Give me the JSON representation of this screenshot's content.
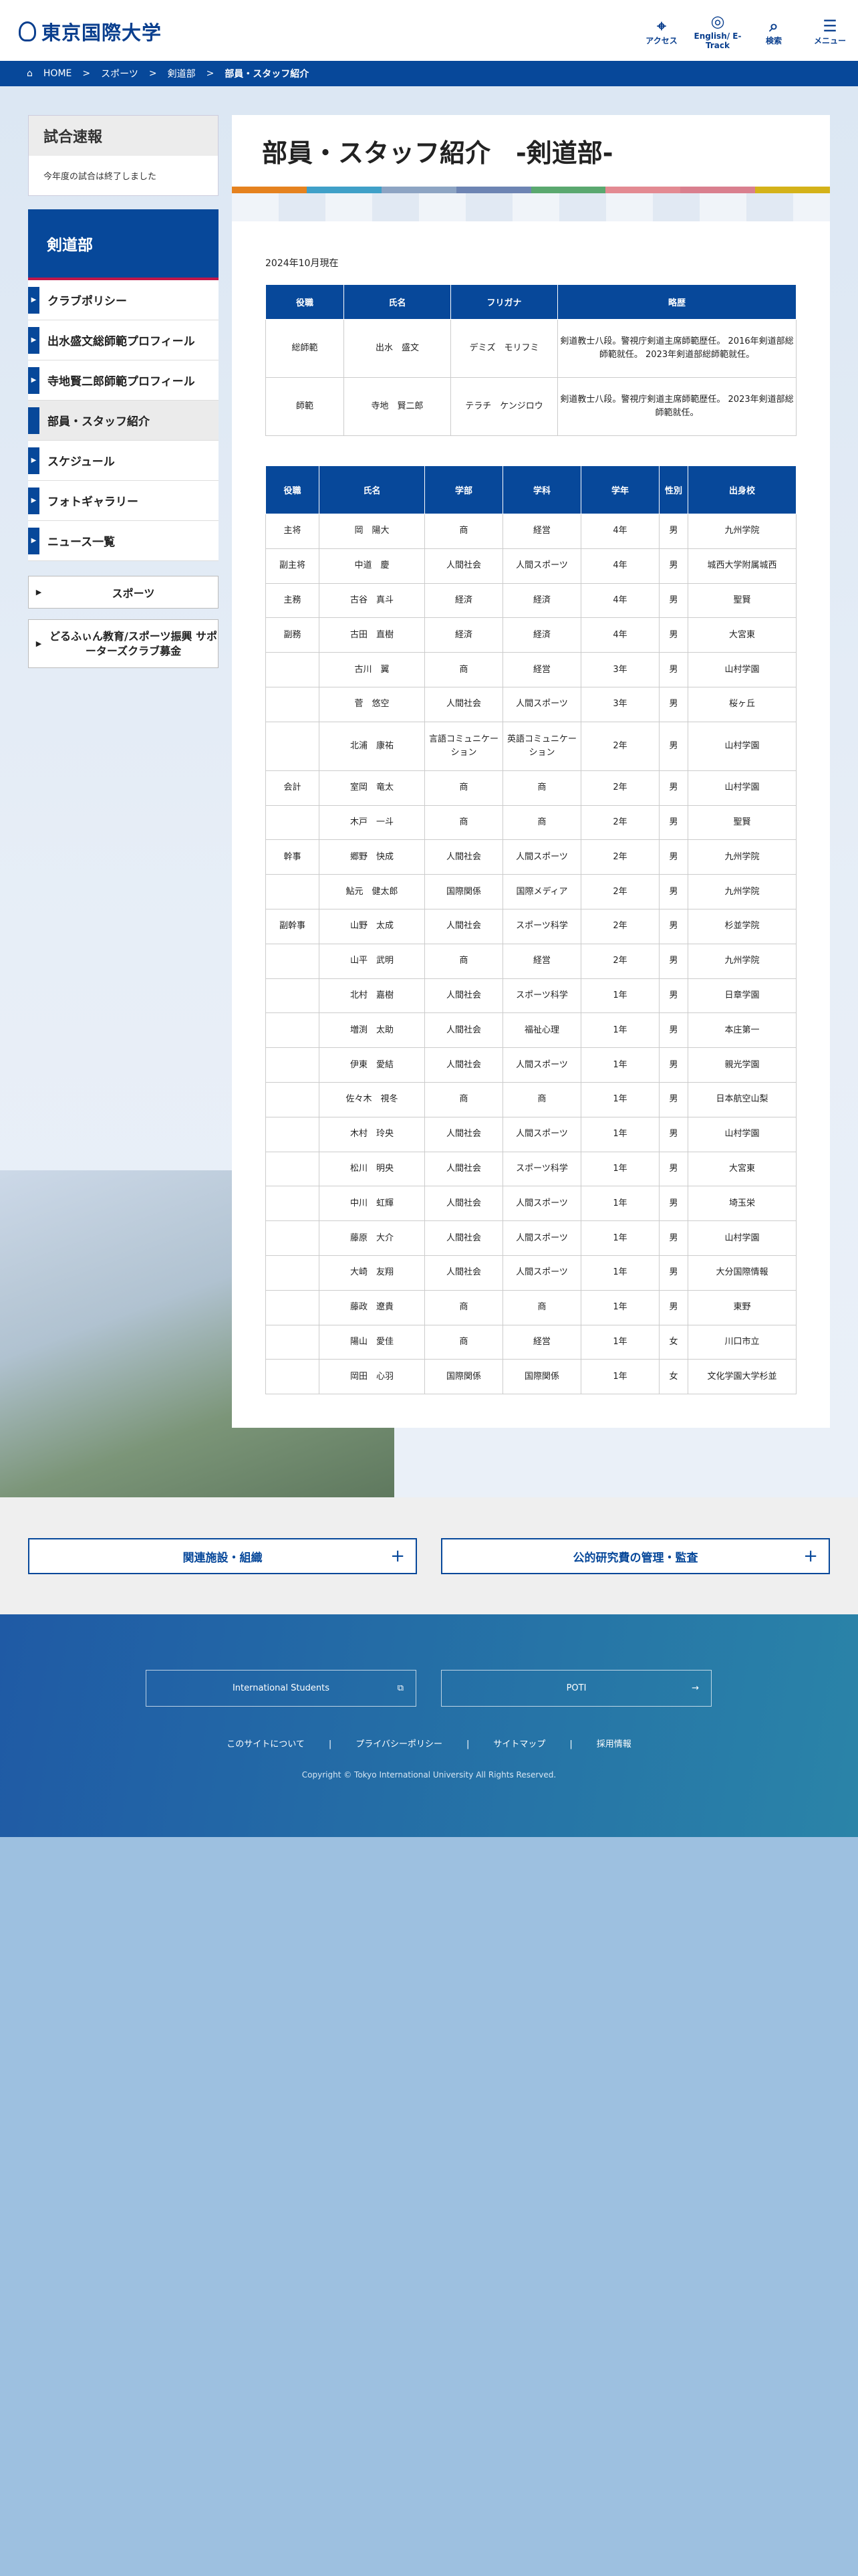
{
  "header": {
    "logo": "東京国際大学",
    "icons": [
      {
        "name": "map-pin-icon",
        "glyph": "⌖",
        "label": "アクセス"
      },
      {
        "name": "globe-icon",
        "glyph": "◎",
        "label": "English/ E-Track"
      },
      {
        "name": "search-icon",
        "glyph": "⌕",
        "label": "検索"
      },
      {
        "name": "menu-icon",
        "glyph": "☰",
        "label": "メニュー"
      }
    ]
  },
  "breadcrumb": [
    "HOME",
    "スポーツ",
    "剣道部",
    "部員・スタッフ紹介"
  ],
  "sidebar": {
    "score_title": "試合速報",
    "score_text": "今年度の試合は終了しました",
    "club_title": "剣道部",
    "menu": [
      "クラブポリシー",
      "出水盛文総師範プロフィール",
      "寺地賢二郎師範プロフィール",
      "部員・スタッフ紹介",
      "スケジュール",
      "フォトギャラリー",
      "ニュース一覧"
    ],
    "active_index": 3,
    "btn_sports": "スポーツ",
    "btn_support": "どるふぃん教育/スポーツ振興 サポーターズクラブ募金"
  },
  "main": {
    "title": "部員・スタッフ紹介　-剣道部-",
    "date": "2024年10月現在",
    "bar_colors": [
      "#e5821f",
      "#3fa0c8",
      "#8da4c3",
      "#6d84b3",
      "#5aa86f",
      "#e38a92",
      "#d97f8e",
      "#d4b219"
    ],
    "staff_headers": [
      "役職",
      "氏名",
      "フリガナ",
      "略歴"
    ],
    "staff": [
      [
        "総師範",
        "出水　盛文",
        "デミズ　モリフミ",
        "剣道教士八段。警視庁剣道主席師範歴任。 2016年剣道部総師範就任。 2023年剣道部総師範就任。"
      ],
      [
        "師範",
        "寺地　賢二郎",
        "テラチ　ケンジロウ",
        "剣道教士八段。警視庁剣道主席師範歴任。 2023年剣道部総師範就任。"
      ]
    ],
    "member_headers": [
      "役職",
      "氏名",
      "学部",
      "学科",
      "学年",
      "性別",
      "出身校"
    ],
    "members": [
      [
        "主将",
        "岡　陽大",
        "商",
        "経営",
        "4年",
        "男",
        "九州学院"
      ],
      [
        "副主将",
        "中道　慶",
        "人間社会",
        "人間スポーツ",
        "4年",
        "男",
        "城西大学附属城西"
      ],
      [
        "主務",
        "古谷　真斗",
        "経済",
        "経済",
        "4年",
        "男",
        "聖賢"
      ],
      [
        "副務",
        "古田　直樹",
        "経済",
        "経済",
        "4年",
        "男",
        "大宮東"
      ],
      [
        "",
        "古川　翼",
        "商",
        "経営",
        "3年",
        "男",
        "山村学園"
      ],
      [
        "",
        "菅　悠空",
        "人間社会",
        "人間スポーツ",
        "3年",
        "男",
        "桜ヶ丘"
      ],
      [
        "",
        "北浦　康祐",
        "言語コミュニケーション",
        "英語コミュニケーション",
        "2年",
        "男",
        "山村学園"
      ],
      [
        "会計",
        "室岡　竜太",
        "商",
        "商",
        "2年",
        "男",
        "山村学園"
      ],
      [
        "",
        "木戸　一斗",
        "商",
        "商",
        "2年",
        "男",
        "聖賢"
      ],
      [
        "幹事",
        "郷野　快成",
        "人間社会",
        "人間スポーツ",
        "2年",
        "男",
        "九州学院"
      ],
      [
        "",
        "鮎元　健太郎",
        "国際関係",
        "国際メディア",
        "2年",
        "男",
        "九州学院"
      ],
      [
        "副幹事",
        "山野　太成",
        "人間社会",
        "スポーツ科学",
        "2年",
        "男",
        "杉並学院"
      ],
      [
        "",
        "山平　武明",
        "商",
        "経営",
        "2年",
        "男",
        "九州学院"
      ],
      [
        "",
        "北村　嘉樹",
        "人間社会",
        "スポーツ科学",
        "1年",
        "男",
        "日章学園"
      ],
      [
        "",
        "増渕　太助",
        "人間社会",
        "福祉心理",
        "1年",
        "男",
        "本庄第一"
      ],
      [
        "",
        "伊東　愛結",
        "人間社会",
        "人間スポーツ",
        "1年",
        "男",
        "親光学園"
      ],
      [
        "",
        "佐々木　視冬",
        "商",
        "商",
        "1年",
        "男",
        "日本航空山梨"
      ],
      [
        "",
        "木村　玲央",
        "人間社会",
        "人間スポーツ",
        "1年",
        "男",
        "山村学園"
      ],
      [
        "",
        "松川　明央",
        "人間社会",
        "スポーツ科学",
        "1年",
        "男",
        "大宮東"
      ],
      [
        "",
        "中川　虹輝",
        "人間社会",
        "人間スポーツ",
        "1年",
        "男",
        "埼玉栄"
      ],
      [
        "",
        "藤原　大介",
        "人間社会",
        "人間スポーツ",
        "1年",
        "男",
        "山村学園"
      ],
      [
        "",
        "大崎　友翔",
        "人間社会",
        "人間スポーツ",
        "1年",
        "男",
        "大分国際情報"
      ],
      [
        "",
        "藤政　遼貴",
        "商",
        "商",
        "1年",
        "男",
        "東野"
      ],
      [
        "",
        "陽山　愛佳",
        "商",
        "経営",
        "1年",
        "女",
        "川口市立"
      ],
      [
        "",
        "岡田　心羽",
        "国際関係",
        "国際関係",
        "1年",
        "女",
        "文化学園大学杉並"
      ]
    ]
  },
  "related": {
    "btn1": "関連施設・組織",
    "btn2": "公的研究費の管理・監査"
  },
  "footer": {
    "btn1": "International Students",
    "btn2": "POTI",
    "links": [
      "このサイトについて",
      "プライバシーポリシー",
      "サイトマップ",
      "採用情報"
    ],
    "copyright": "Copyright © Tokyo International University All Rights Reserved."
  }
}
